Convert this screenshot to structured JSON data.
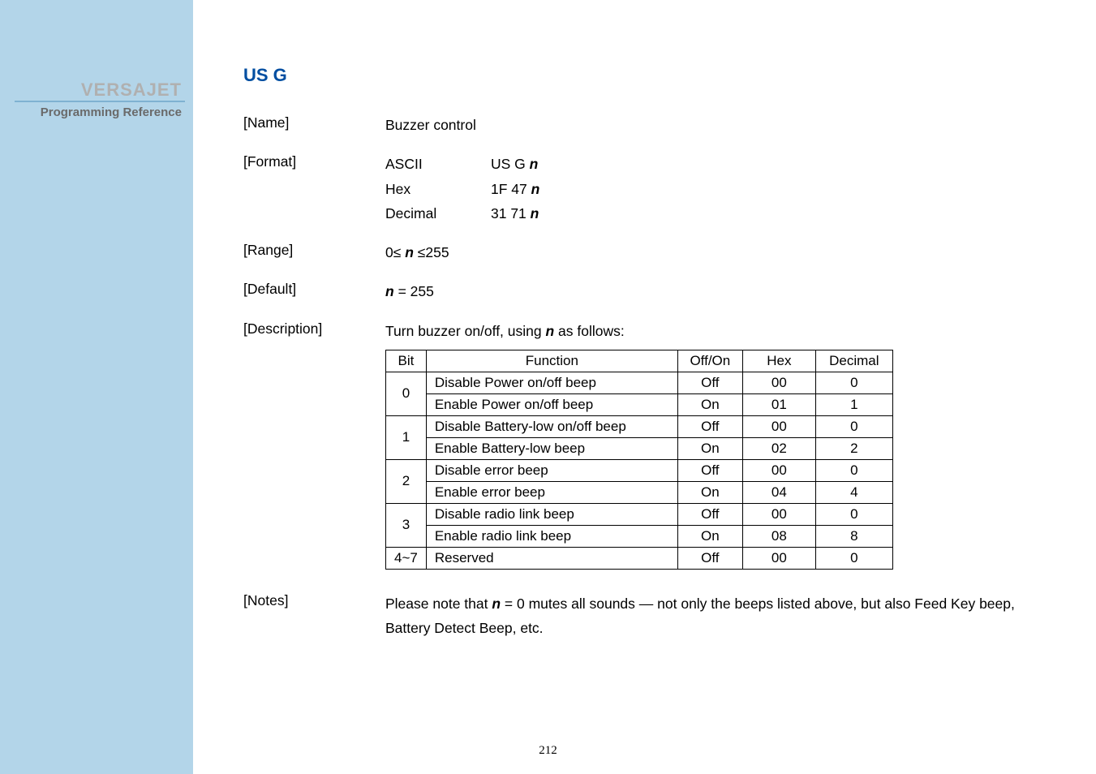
{
  "sidebar": {
    "title": "VERSAJET",
    "subtitle": "Programming Reference"
  },
  "command": {
    "title": "US G",
    "name_label": "[Name]",
    "name_value": "Buzzer control",
    "format_label": "[Format]",
    "format": {
      "ascii_label": "ASCII",
      "ascii_value_prefix": "US G ",
      "hex_label": "Hex",
      "hex_value_prefix": "1F 47 ",
      "dec_label": "Decimal",
      "dec_value_prefix": "31 71 ",
      "param": "n"
    },
    "range_label": "[Range]",
    "range_value_prefix": "0≤ ",
    "range_value_param": "n",
    "range_value_suffix": " ≤255",
    "default_label": "[Default]",
    "default_param": "n",
    "default_rest": " = 255",
    "desc_label": "[Description]",
    "desc_text_prefix": "Turn buzzer on/off, using ",
    "desc_text_param": "n",
    "desc_text_suffix": " as follows:",
    "table": {
      "headers": {
        "bit": "Bit",
        "function": "Function",
        "offon": "Off/On",
        "hex": "Hex",
        "dec": "Decimal"
      },
      "rows": [
        {
          "bit": "0",
          "func": "Disable Power on/off beep",
          "offon": "Off",
          "hex": "00",
          "dec": "0"
        },
        {
          "bit": "",
          "func": "Enable Power on/off beep",
          "offon": "On",
          "hex": "01",
          "dec": "1"
        },
        {
          "bit": "1",
          "func": "Disable Battery-low on/off beep",
          "offon": "Off",
          "hex": "00",
          "dec": "0"
        },
        {
          "bit": "",
          "func": "Enable Battery-low beep",
          "offon": "On",
          "hex": "02",
          "dec": "2"
        },
        {
          "bit": "2",
          "func": "Disable error beep",
          "offon": "Off",
          "hex": "00",
          "dec": "0"
        },
        {
          "bit": "",
          "func": "Enable error beep",
          "offon": "On",
          "hex": "04",
          "dec": "4"
        },
        {
          "bit": "3",
          "func": "Disable radio link beep",
          "offon": "Off",
          "hex": "00",
          "dec": "0"
        },
        {
          "bit": "",
          "func": "Enable radio link beep",
          "offon": "On",
          "hex": "08",
          "dec": "8"
        },
        {
          "bit": "4~7",
          "func": "Reserved",
          "offon": "Off",
          "hex": "00",
          "dec": "0"
        }
      ]
    },
    "notes_label": "[Notes]",
    "notes_prefix": "Please note that ",
    "notes_param": "n",
    "notes_mid": " = 0 mutes all sounds — not only the beeps listed above, but also Feed Key beep, Battery Detect Beep, etc."
  },
  "page_number": "212"
}
